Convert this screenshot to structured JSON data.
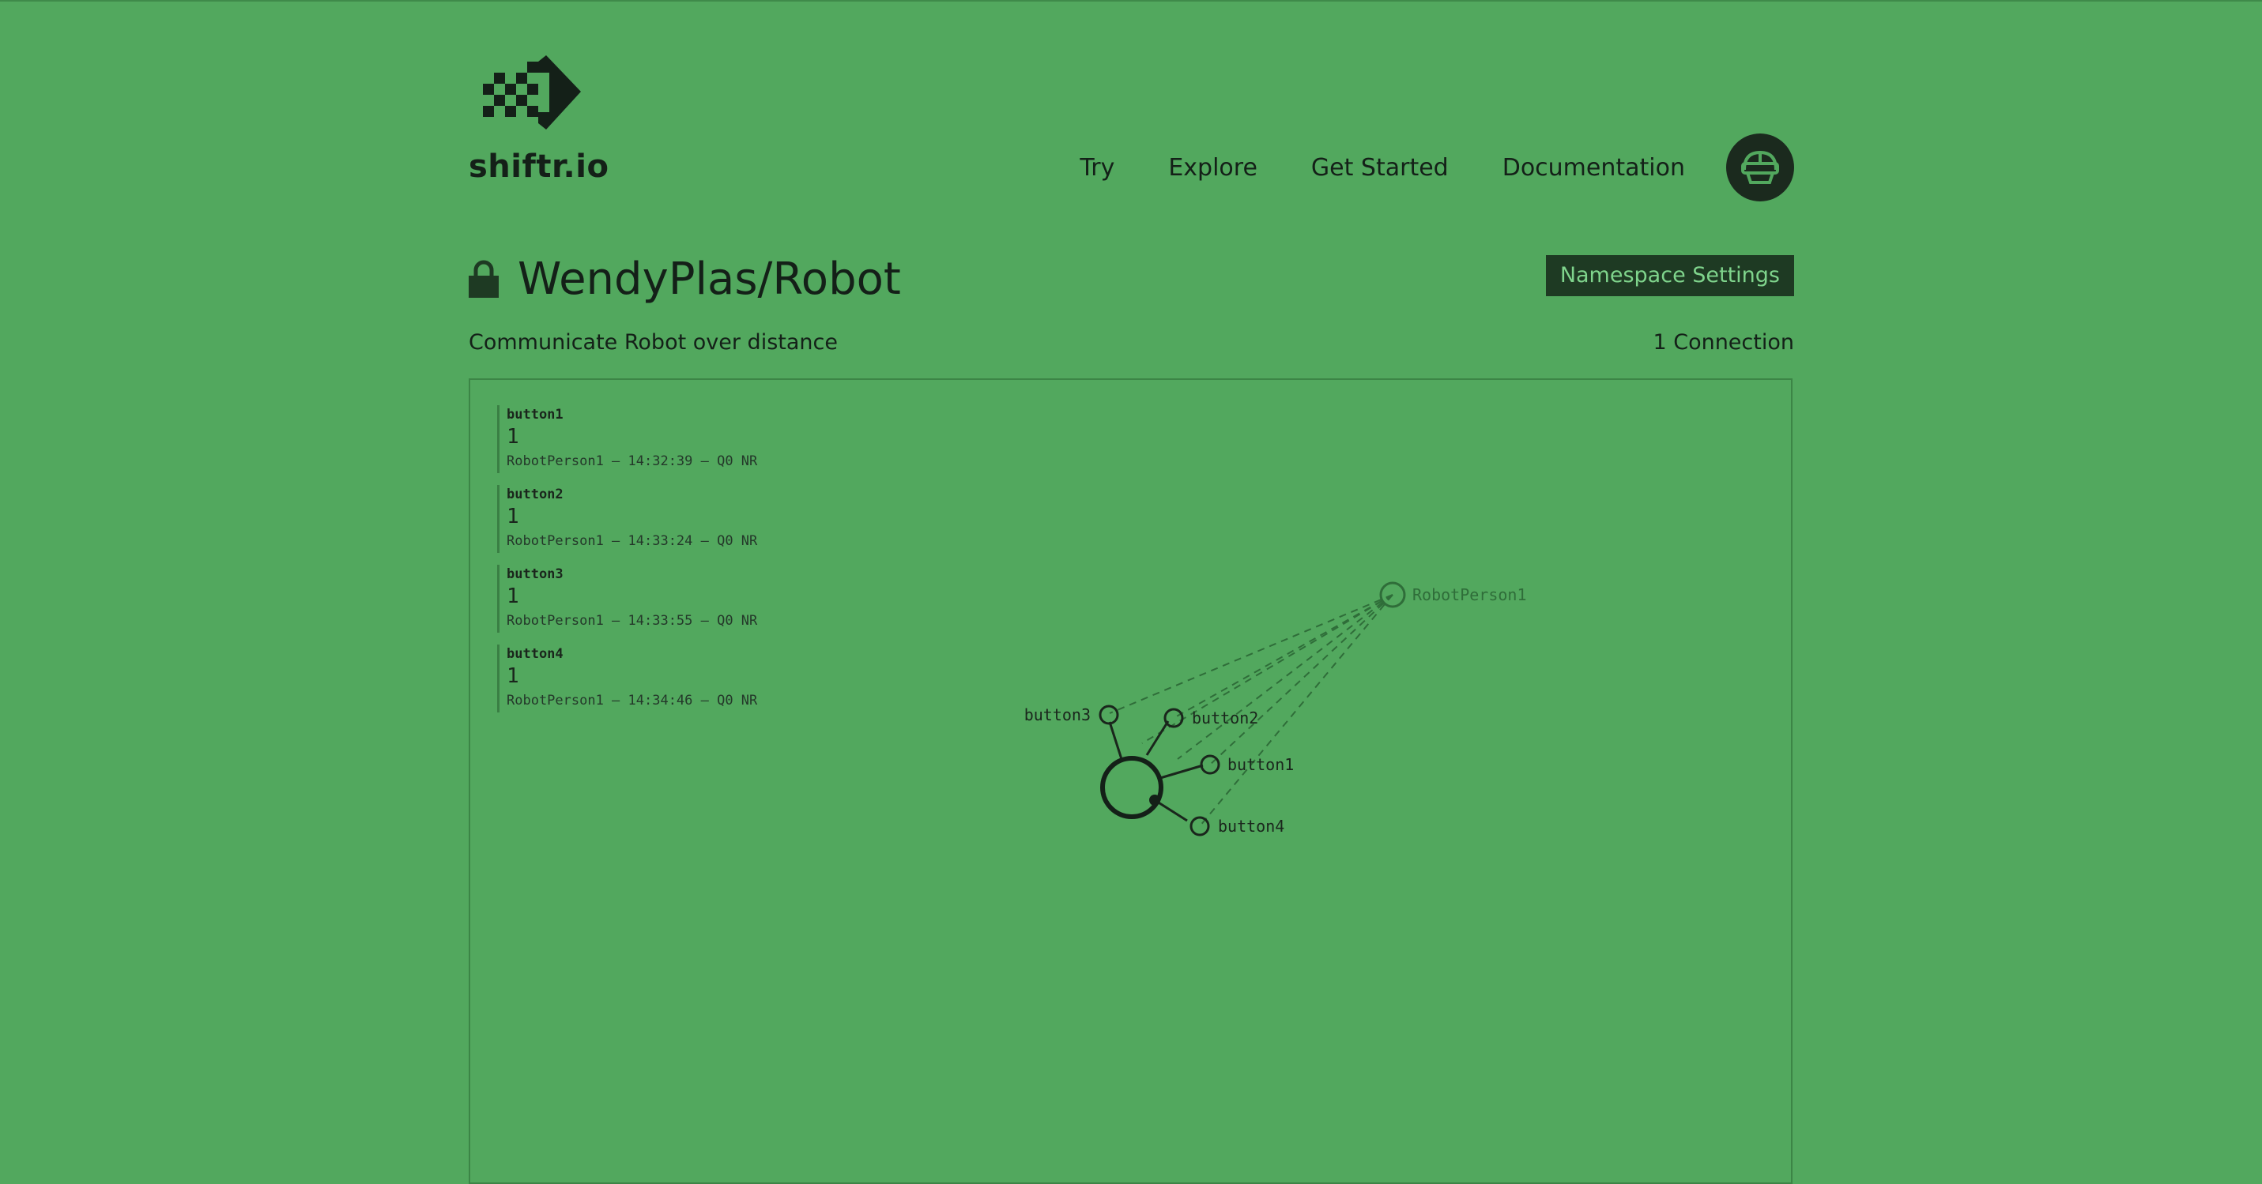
{
  "brand": {
    "name": "shiftr.io",
    "logo_icon": "shiftr-arrow-logo"
  },
  "nav": {
    "items": [
      "Try",
      "Explore",
      "Get Started",
      "Documentation"
    ],
    "avatar_icon": "robot-avatar-icon"
  },
  "namespace": {
    "title": "WendyPlas/Robot",
    "description": "Communicate Robot over distance",
    "connections": "1 Connection",
    "settings_label": "Namespace Settings",
    "private": true
  },
  "messages": [
    {
      "topic": "button1",
      "value": "1",
      "meta": "RobotPerson1 – 14:32:39 – Q0 NR"
    },
    {
      "topic": "button2",
      "value": "1",
      "meta": "RobotPerson1 – 14:33:24 – Q0 NR"
    },
    {
      "topic": "button3",
      "value": "1",
      "meta": "RobotPerson1 – 14:33:55 – Q0 NR"
    },
    {
      "topic": "button4",
      "value": "1",
      "meta": "RobotPerson1 – 14:34:46 – Q0 NR"
    }
  ],
  "graph": {
    "client": "RobotPerson1",
    "topics": [
      "button1",
      "button2",
      "button3",
      "button4"
    ]
  },
  "colors": {
    "background": "#52a85e",
    "dark": "#142018",
    "button_bg": "#1e3a23",
    "button_text": "#7fd48c"
  }
}
